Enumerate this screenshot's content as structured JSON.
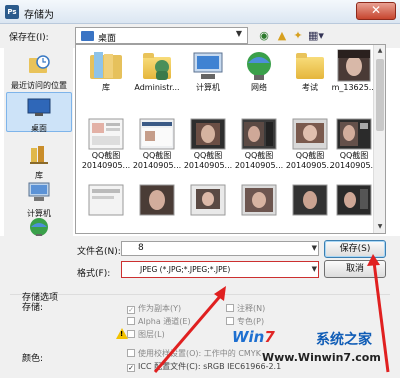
{
  "window": {
    "title": "存储为",
    "app_icon": "Ps",
    "close_label": "✕"
  },
  "toolbar": {
    "save_in_label": "保存在(I):",
    "location": "桌面"
  },
  "places": [
    {
      "label": "最近访问的位置",
      "icon": "recent-places-icon"
    },
    {
      "label": "桌面",
      "icon": "desktop-icon",
      "selected": true
    },
    {
      "label": "库",
      "icon": "library-icon"
    },
    {
      "label": "计算机",
      "icon": "computer-icon"
    },
    {
      "label": "网络",
      "icon": "network-icon"
    }
  ],
  "files_row1": [
    {
      "name": "库",
      "icon": "library-icon"
    },
    {
      "name": "Administr...",
      "icon": "user-folder-icon"
    },
    {
      "name": "计算机",
      "icon": "computer-icon"
    },
    {
      "name": "网络",
      "icon": "network-icon"
    },
    {
      "name": "考试",
      "icon": "folder-icon"
    },
    {
      "name": "m_13625...",
      "icon": "photo-icon"
    }
  ],
  "files_row2": [
    {
      "line1": "QQ截图",
      "line2": "20140905..."
    },
    {
      "line1": "QQ截图",
      "line2": "20140905..."
    },
    {
      "line1": "QQ截图",
      "line2": "20140905..."
    },
    {
      "line1": "QQ截图",
      "line2": "20140905..."
    },
    {
      "line1": "QQ截图",
      "line2": "20140905..."
    },
    {
      "line1": "QQ截图",
      "line2": "20140905..."
    }
  ],
  "form": {
    "filename_label": "文件名(N):",
    "filename_value": "8",
    "format_label": "格式(F):",
    "format_value": "JPEG (*.JPG;*.JPEG;*.JPE)",
    "save_button": "保存(S)",
    "cancel_button": "取消"
  },
  "options": {
    "title": "存储选项",
    "store_label": "存储:",
    "as_copy": "作为副本(Y)",
    "annotations": "注释(N)",
    "alpha": "Alpha 通道(E)",
    "spot": "专色(P)",
    "layers": "图层(L)",
    "color_label": "颜色:",
    "use_proof": "使用校样设置(O):",
    "proof_value": "工作中的 CMYK",
    "icc_profile": "ICC 配置文件(C):",
    "icc_value": "sRGB IEC61966-2.1"
  },
  "watermark": {
    "logo_prefix": "Win",
    "logo_seven": "7",
    "brand": "系统之家",
    "url": "Www.Winwin7.com"
  },
  "colors": {
    "accent": "#3c7fb1",
    "arrow": "#e02020"
  }
}
